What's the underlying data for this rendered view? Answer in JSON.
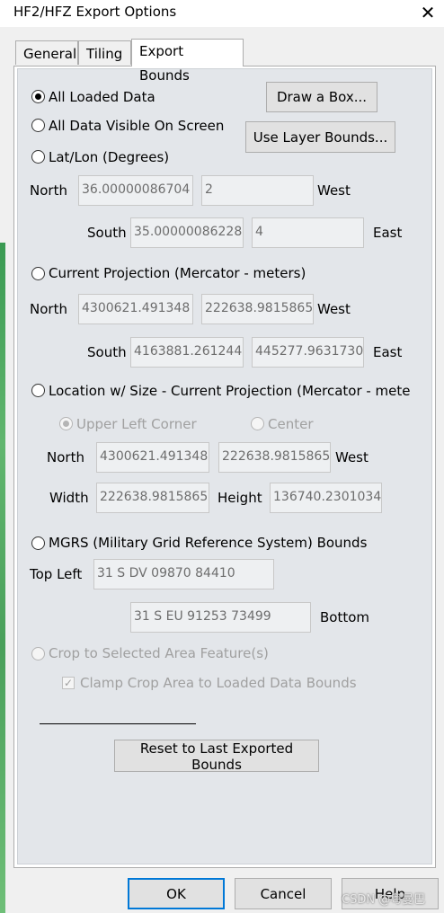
{
  "window": {
    "title": "HF2/HFZ Export Options"
  },
  "tabs": [
    "General",
    "Tiling",
    "Export Bounds"
  ],
  "buttons": {
    "draw_box": "Draw a Box...",
    "use_layer_bounds": "Use Layer Bounds...",
    "reset": "Reset to Last Exported Bounds",
    "ok": "OK",
    "cancel": "Cancel",
    "help": "Help"
  },
  "options": {
    "all_loaded": "All Loaded Data",
    "all_visible": "All Data Visible On Screen",
    "latlon": "Lat/Lon (Degrees)",
    "current_proj": "Current Projection (Mercator - meters)",
    "location_size": "Location w/ Size - Current Projection (Mercator - mete",
    "mgrs": "MGRS (Military Grid Reference System) Bounds",
    "crop": "Crop to Selected Area Feature(s)",
    "clamp": "Clamp Crop Area to Loaded Data Bounds",
    "upper_left": "Upper Left Corner",
    "center": "Center"
  },
  "labels": {
    "north": "North",
    "south": "South",
    "west": "West",
    "east": "East",
    "width": "Width",
    "height": "Height",
    "top_left": "Top Left",
    "bottom": "Bottom"
  },
  "latlon": {
    "north": "36.00000086704",
    "west": "2",
    "south": "35.00000086228",
    "east": "4"
  },
  "proj": {
    "north": "4300621.491348",
    "west": "222638.9815865",
    "south": "4163881.261244",
    "east": "445277.9631730"
  },
  "locsize": {
    "north": "4300621.491348",
    "west": "222638.9815865",
    "width": "222638.9815865",
    "height": "136740.2301034"
  },
  "mgrs": {
    "top_left": "31 S DV 09870 84410",
    "bottom_right": "31 S EU 91253 73499"
  },
  "watermark": "CSDN @粤曼巴"
}
